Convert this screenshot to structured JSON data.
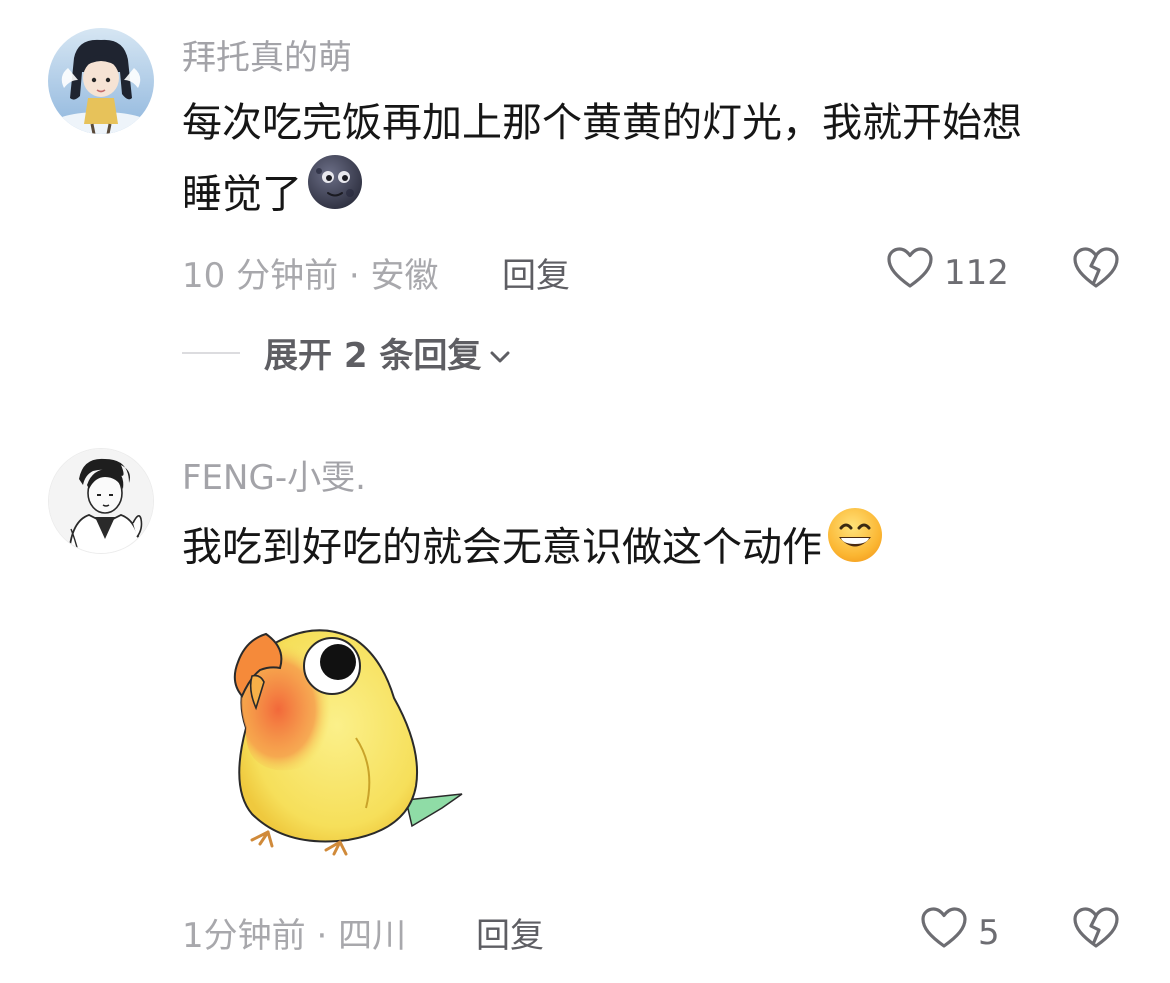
{
  "comments": [
    {
      "username": "拜托真的萌",
      "text_line1": "每次吃完饭再加上那个黄黄的灯光，我就开始想",
      "text_line2": "睡觉了",
      "time": "10 分钟前",
      "separator": "·",
      "location": "安徽",
      "reply_label": "回复",
      "likes": "112",
      "expand_label": "展开 2 条回复",
      "emoji": "new-moon-face"
    },
    {
      "username": "FENG-小雯.",
      "text_line1": "我吃到好吃的就会无意识做这个动作",
      "time": "1分钟前",
      "separator": "·",
      "location": "四川",
      "reply_label": "回复",
      "likes": "5",
      "emoji": "grinning-face",
      "sticker": "yellow-parrot-sticker"
    }
  ],
  "colors": {
    "username": "#a3a3a8",
    "text": "#161616",
    "meta": "#a8a8ac",
    "action": "#5e5e63"
  },
  "icons": {
    "like": "heart-outline-icon",
    "dislike": "broken-heart-icon",
    "expand": "chevron-down-icon"
  }
}
